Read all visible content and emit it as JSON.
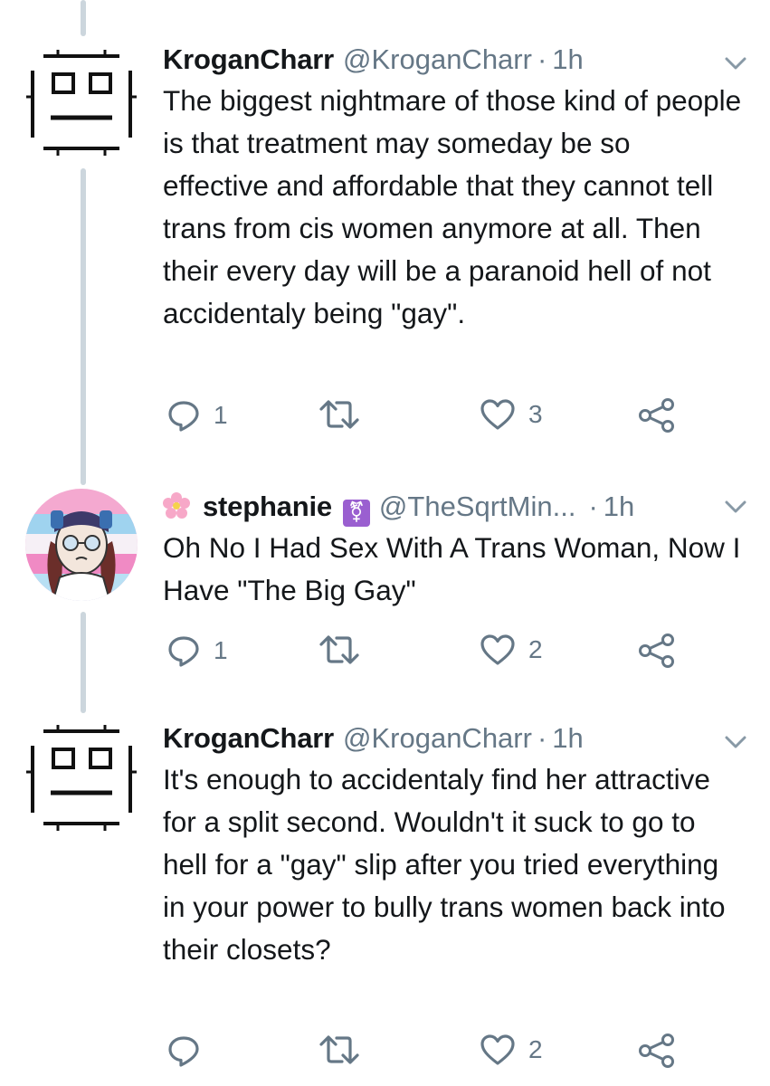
{
  "tweets": [
    {
      "name": "KroganCharr",
      "handle": "@KroganCharr",
      "separator": "·",
      "time": "1h",
      "text": "The biggest nightmare of those kind of people is that treatment may someday be so effective and affordable that they cannot tell trans from cis women anymore at all. Then their every day will be a paranoid hell of not accidentaly being \"gay\".",
      "reply_count": "1",
      "retweet_count": "",
      "like_count": "3"
    },
    {
      "name": "stephanie",
      "handle": "@TheSqrtMin...",
      "separator": "·",
      "time": "1h",
      "name_symbol": "⚧",
      "text": "Oh No I Had Sex With A Trans Woman, Now I Have \"The Big Gay\"",
      "reply_count": "1",
      "retweet_count": "",
      "like_count": "2"
    },
    {
      "name": "KroganCharr",
      "handle": "@KroganCharr",
      "separator": "·",
      "time": "1h",
      "text": "It's enough to accidentaly find her attractive for a split second. Wouldn't it suck to go to hell for a \"gay\" slip after you tried everything in your power to bully trans women back into their closets?",
      "reply_count": "",
      "retweet_count": "",
      "like_count": "2"
    }
  ],
  "colors": {
    "text": "#14171a",
    "secondary": "#657786",
    "thread_line": "#ccd6dd"
  },
  "icons": [
    "reply-icon",
    "retweet-icon",
    "like-icon",
    "share-icon",
    "chevron-down-icon"
  ]
}
